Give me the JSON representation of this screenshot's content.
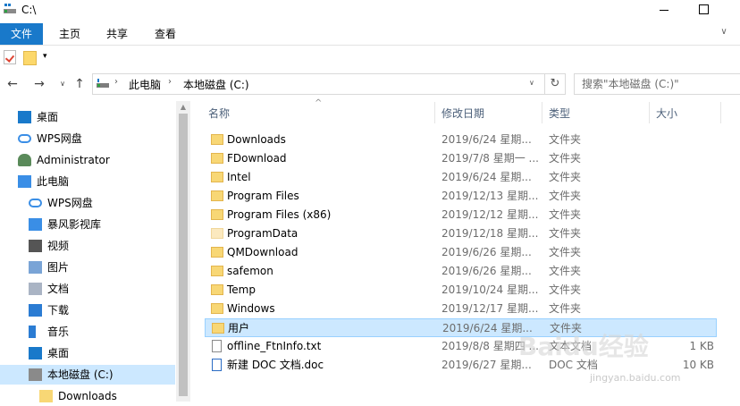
{
  "window": {
    "title": "C:\\"
  },
  "ribbon": {
    "tabs": [
      {
        "label": "文件",
        "active": true
      },
      {
        "label": "主页"
      },
      {
        "label": "共享"
      },
      {
        "label": "查看"
      }
    ],
    "expand_glyph": "∨"
  },
  "quick_access": {
    "dropdown_glyph": "▾"
  },
  "nav": {
    "back": "←",
    "forward": "→",
    "recent": "∨",
    "up": "↑",
    "breadcrumb": [
      "此电脑",
      "本地磁盘 (C:)"
    ],
    "sep": "›",
    "address_dropdown": "∨",
    "refresh": "↻",
    "search_placeholder": "搜索\"本地磁盘 (C:)\""
  },
  "navpane": {
    "items": [
      {
        "label": "桌面",
        "icon": "desktop-icon",
        "level": 0
      },
      {
        "label": "WPS网盘",
        "icon": "cloud-icon",
        "level": 0
      },
      {
        "label": "Administrator",
        "icon": "user-icon",
        "level": 0
      },
      {
        "label": "此电脑",
        "icon": "computer-icon",
        "level": 0
      },
      {
        "label": "WPS网盘",
        "icon": "cloud-icon",
        "level": 1
      },
      {
        "label": "暴风影视库",
        "icon": "media-library-icon",
        "level": 1
      },
      {
        "label": "视频",
        "icon": "video-icon",
        "level": 1
      },
      {
        "label": "图片",
        "icon": "pictures-icon",
        "level": 1
      },
      {
        "label": "文档",
        "icon": "documents-icon",
        "level": 1
      },
      {
        "label": "下载",
        "icon": "download-icon",
        "level": 1
      },
      {
        "label": "音乐",
        "icon": "music-icon",
        "level": 1
      },
      {
        "label": "桌面",
        "icon": "desktop-icon",
        "level": 1
      },
      {
        "label": "本地磁盘 (C:)",
        "icon": "drive-icon",
        "level": 1,
        "selected": true
      },
      {
        "label": "Downloads",
        "icon": "folder-icon",
        "level": 2
      }
    ]
  },
  "filelist": {
    "columns": {
      "name": "名称",
      "date": "修改日期",
      "type": "类型",
      "size": "大小"
    },
    "sort_glyph": "^",
    "rows": [
      {
        "name": "Downloads",
        "date": "2019/6/24 星期...",
        "type": "文件夹",
        "size": "",
        "icon": "folder-icon"
      },
      {
        "name": "FDownload",
        "date": "2019/7/8 星期一 ...",
        "type": "文件夹",
        "size": "",
        "icon": "folder-icon"
      },
      {
        "name": "Intel",
        "date": "2019/6/24 星期...",
        "type": "文件夹",
        "size": "",
        "icon": "folder-icon"
      },
      {
        "name": "Program Files",
        "date": "2019/12/13 星期...",
        "type": "文件夹",
        "size": "",
        "icon": "folder-icon"
      },
      {
        "name": "Program Files (x86)",
        "date": "2019/12/12 星期...",
        "type": "文件夹",
        "size": "",
        "icon": "folder-icon"
      },
      {
        "name": "ProgramData",
        "date": "2019/12/18 星期...",
        "type": "文件夹",
        "size": "",
        "icon": "hidden-folder-icon"
      },
      {
        "name": "QMDownload",
        "date": "2019/6/26 星期...",
        "type": "文件夹",
        "size": "",
        "icon": "folder-icon"
      },
      {
        "name": "safemon",
        "date": "2019/6/26 星期...",
        "type": "文件夹",
        "size": "",
        "icon": "folder-icon"
      },
      {
        "name": "Temp",
        "date": "2019/10/24 星期...",
        "type": "文件夹",
        "size": "",
        "icon": "folder-icon"
      },
      {
        "name": "Windows",
        "date": "2019/12/17 星期...",
        "type": "文件夹",
        "size": "",
        "icon": "folder-icon"
      },
      {
        "name": "用户",
        "date": "2019/6/24 星期...",
        "type": "文件夹",
        "size": "",
        "icon": "folder-icon",
        "selected": true
      },
      {
        "name": "offline_FtnInfo.txt",
        "date": "2019/8/8 星期四 ...",
        "type": "文本文档",
        "size": "1 KB",
        "icon": "text-file-icon"
      },
      {
        "name": "新建 DOC 文档.doc",
        "date": "2019/6/27 星期...",
        "type": "DOC 文档",
        "size": "10 KB",
        "icon": "doc-file-icon"
      }
    ]
  },
  "watermark": {
    "text": "Baidu经验",
    "sub": "jingyan.baidu.com"
  },
  "colors": {
    "accent": "#1979ca",
    "selection": "#cce8ff",
    "selection_border": "#99d1ff",
    "header_text": "#4c607a"
  }
}
